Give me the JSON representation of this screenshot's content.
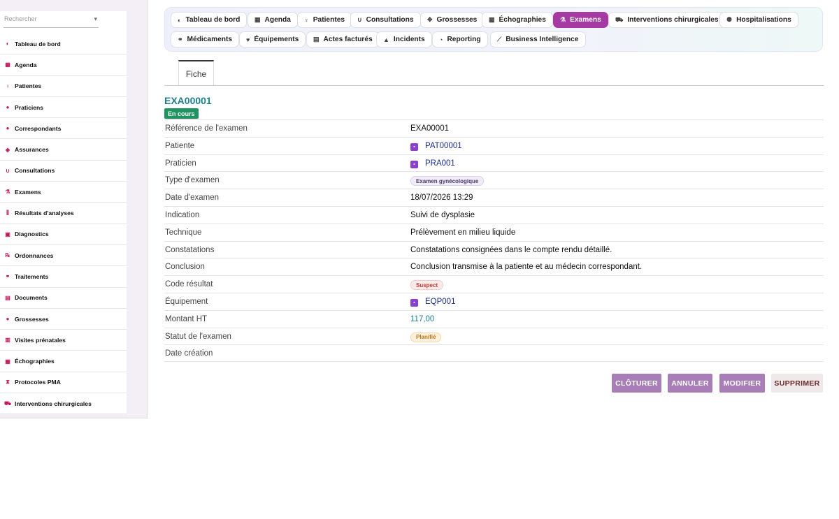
{
  "sidebar": {
    "search_placeholder": "Rechercher",
    "items": [
      {
        "label": "Tableau de bord",
        "icon": "dashboard-icon"
      },
      {
        "label": "Agenda",
        "icon": "calendar-icon"
      },
      {
        "label": "Patientes",
        "icon": "female-icon"
      },
      {
        "label": "Praticiens",
        "icon": "user-doctor-icon"
      },
      {
        "label": "Correspondants",
        "icon": "user-icon"
      },
      {
        "label": "Assurances",
        "icon": "shield-icon"
      },
      {
        "label": "Consultations",
        "icon": "stethoscope-icon"
      },
      {
        "label": "Examens",
        "icon": "microscope-icon"
      },
      {
        "label": "Résultats d'analyses",
        "icon": "vials-icon"
      },
      {
        "label": "Diagnostics",
        "icon": "notes-medical-icon"
      },
      {
        "label": "Ordonnances",
        "icon": "prescription-icon"
      },
      {
        "label": "Traitements",
        "icon": "pills-icon"
      },
      {
        "label": "Documents",
        "icon": "document-icon"
      },
      {
        "label": "Grossesses",
        "icon": "baby-icon"
      },
      {
        "label": "Visites prénatales",
        "icon": "clipboard-icon"
      },
      {
        "label": "Échographies",
        "icon": "ultrasound-icon"
      },
      {
        "label": "Protocoles PMA",
        "icon": "hourglass-icon"
      },
      {
        "label": "Interventions chirurgicales",
        "icon": "procedures-icon"
      }
    ]
  },
  "tabs": {
    "row1": [
      {
        "label": "Tableau de bord",
        "icon": "dashboard-icon"
      },
      {
        "label": "Agenda",
        "icon": "calendar-icon"
      },
      {
        "label": "Patientes",
        "icon": "female-icon"
      },
      {
        "label": "Consultations",
        "icon": "stethoscope-icon"
      },
      {
        "label": "Grossesses",
        "icon": "baby-icon"
      },
      {
        "label": "Échographies",
        "icon": "ultrasound-icon"
      },
      {
        "label": "Examens",
        "icon": "microscope-icon"
      },
      {
        "label": "Interventions chirurgicales",
        "icon": "procedures-icon"
      },
      {
        "label": "Hospitalisations",
        "icon": "hospital-user-icon"
      }
    ],
    "row2": [
      {
        "label": "Médicaments",
        "icon": "capsules-icon"
      },
      {
        "label": "Équipements",
        "icon": "heartbeat-icon"
      },
      {
        "label": "Actes facturés",
        "icon": "invoice-icon"
      },
      {
        "label": "Incidents",
        "icon": "warning-icon"
      },
      {
        "label": "Reporting",
        "icon": "pie-chart-icon"
      },
      {
        "label": "Business Intelligence",
        "icon": "line-chart-icon"
      }
    ],
    "active": "Examens",
    "active_color": "#a63aa3"
  },
  "record": {
    "tab_label": "Fiche",
    "id": "EXA00001",
    "status": "En cours",
    "fields": {
      "reference": {
        "label": "Référence de l'examen",
        "value": "EXA00001"
      },
      "patiente": {
        "label": "Patiente",
        "value": "PAT00001"
      },
      "praticien": {
        "label": "Praticien",
        "value": "PRA001"
      },
      "type": {
        "label": "Type d'examen",
        "value": "Examen gynécologique"
      },
      "date": {
        "label": "Date d'examen",
        "value": "18/07/2026 13:29"
      },
      "indication": {
        "label": "Indication",
        "value": "Suivi de dysplasie"
      },
      "technique": {
        "label": "Technique",
        "value": "Prélèvement en milieu liquide"
      },
      "constatations": {
        "label": "Constatations",
        "value": "Constatations consignées dans le compte rendu détaillé."
      },
      "conclusion": {
        "label": "Conclusion",
        "value": "Conclusion transmise à la patiente et au médecin correspondant."
      },
      "code_resultat": {
        "label": "Code résultat",
        "value": "Suspect"
      },
      "equipement": {
        "label": "Équipement",
        "value": "EQP001"
      },
      "montant": {
        "label": "Montant HT",
        "value": "117,00"
      },
      "statut": {
        "label": "Statut de l'examen",
        "value": "Planifié"
      },
      "date_creation": {
        "label": "Date création",
        "value": ""
      }
    }
  },
  "actions": {
    "cloturer": "CLÔTURER",
    "annuler": "ANNULER",
    "modifier": "MODIFIER",
    "supprimer": "SUPPRIMER"
  }
}
